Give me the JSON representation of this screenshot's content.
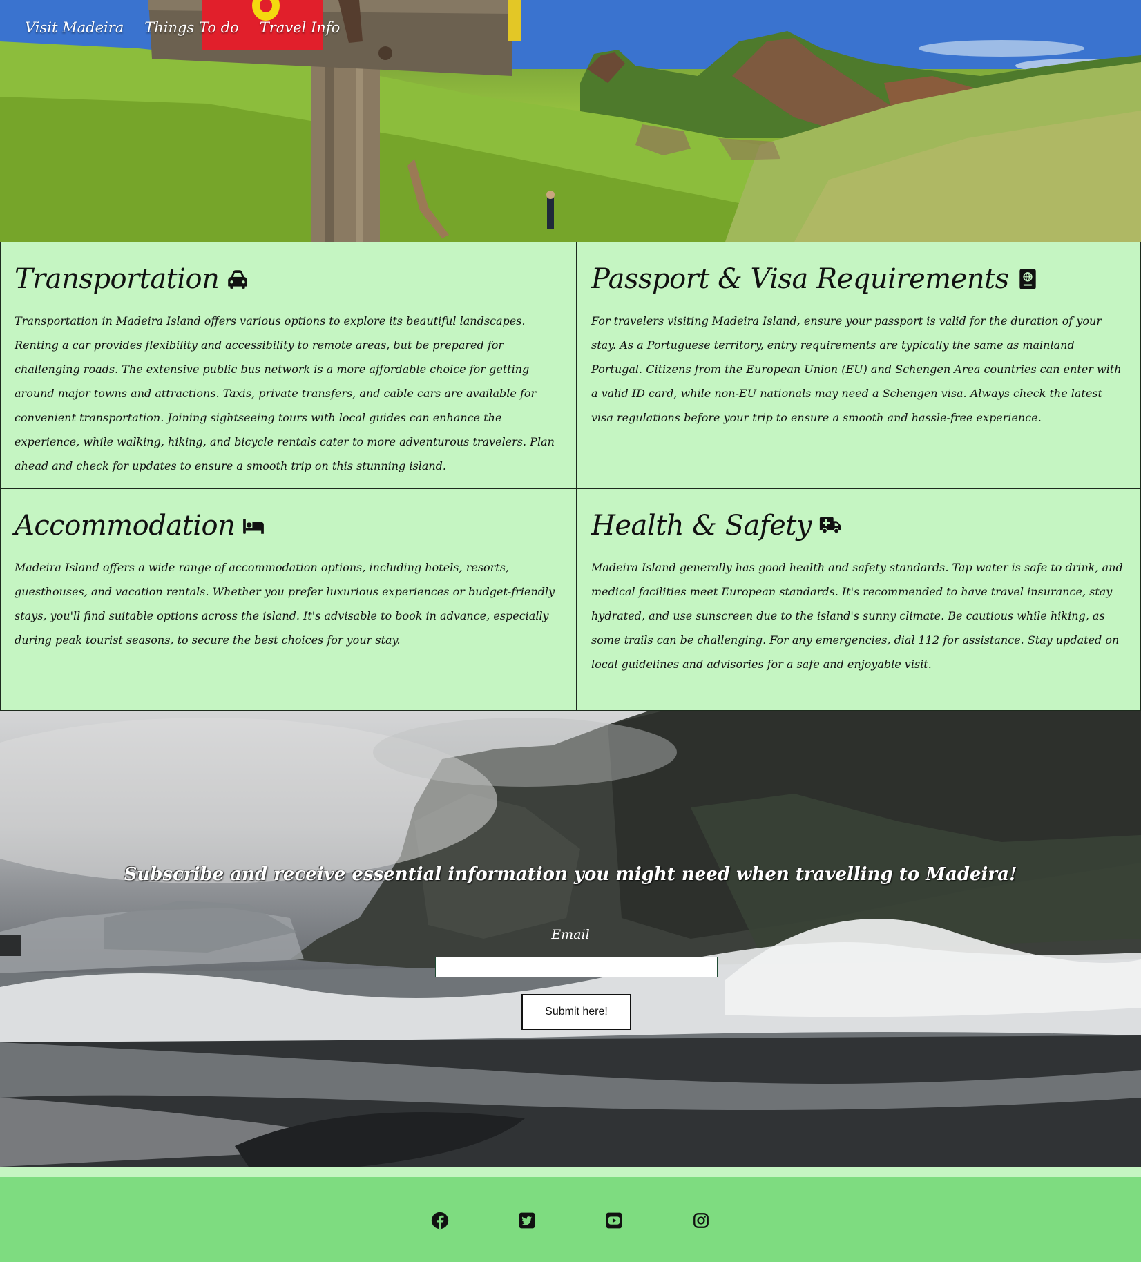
{
  "nav": {
    "items": [
      {
        "label": "Visit Madeira"
      },
      {
        "label": "Things To do"
      },
      {
        "label": "Travel Info"
      }
    ]
  },
  "sections": [
    {
      "title": "Transportation",
      "icon": "car-icon",
      "text": "Transportation in Madeira Island offers various options to explore its beautiful landscapes. Renting a car provides flexibility and accessibility to remote areas, but be prepared for challenging roads. The extensive public bus network is a more affordable choice for getting around major towns and attractions. Taxis, private transfers, and cable cars are available for convenient transportation. Joining sightseeing tours with local guides can enhance the experience, while walking, hiking, and bicycle rentals cater to more adventurous travelers. Plan ahead and check for updates to ensure a smooth trip on this stunning island."
    },
    {
      "title": "Passport & Visa Requirements",
      "icon": "passport-icon",
      "text": "For travelers visiting Madeira Island, ensure your passport is valid for the duration of your stay. As a Portuguese territory, entry requirements are typically the same as mainland Portugal. Citizens from the European Union (EU) and Schengen Area countries can enter with a valid ID card, while non-EU nationals may need a Schengen visa. Always check the latest visa regulations before your trip to ensure a smooth and hassle-free experience."
    },
    {
      "title": "Accommodation",
      "icon": "bed-icon",
      "text": "Madeira Island offers a wide range of accommodation options, including hotels, resorts, guesthouses, and vacation rentals. Whether you prefer luxurious experiences or budget-friendly stays, you'll find suitable options across the island. It's advisable to book in advance, especially during peak tourist seasons, to secure the best choices for your stay."
    },
    {
      "title": "Health & Safety",
      "icon": "ambulance-icon",
      "text": "Madeira Island generally has good health and safety standards. Tap water is safe to drink, and medical facilities meet European standards. It's recommended to have travel insurance, stay hydrated, and use sunscreen due to the island's sunny climate. Be cautious while hiking, as some trails can be challenging. For any emergencies, dial 112 for assistance. Stay updated on local guidelines and advisories for a safe and enjoyable visit."
    }
  ],
  "subscribe": {
    "title": "Subscribe and receive essential information you might need when travelling to Madeira!",
    "email_label": "Email",
    "email_value": "",
    "submit_label": "Submit here!"
  },
  "footer": {
    "icons": [
      "facebook-icon",
      "twitter-icon",
      "youtube-icon",
      "instagram-icon"
    ]
  },
  "colors": {
    "card_bg": "#c5f5c2",
    "footer_bg": "#7edc80",
    "border": "#1d2b1d"
  }
}
